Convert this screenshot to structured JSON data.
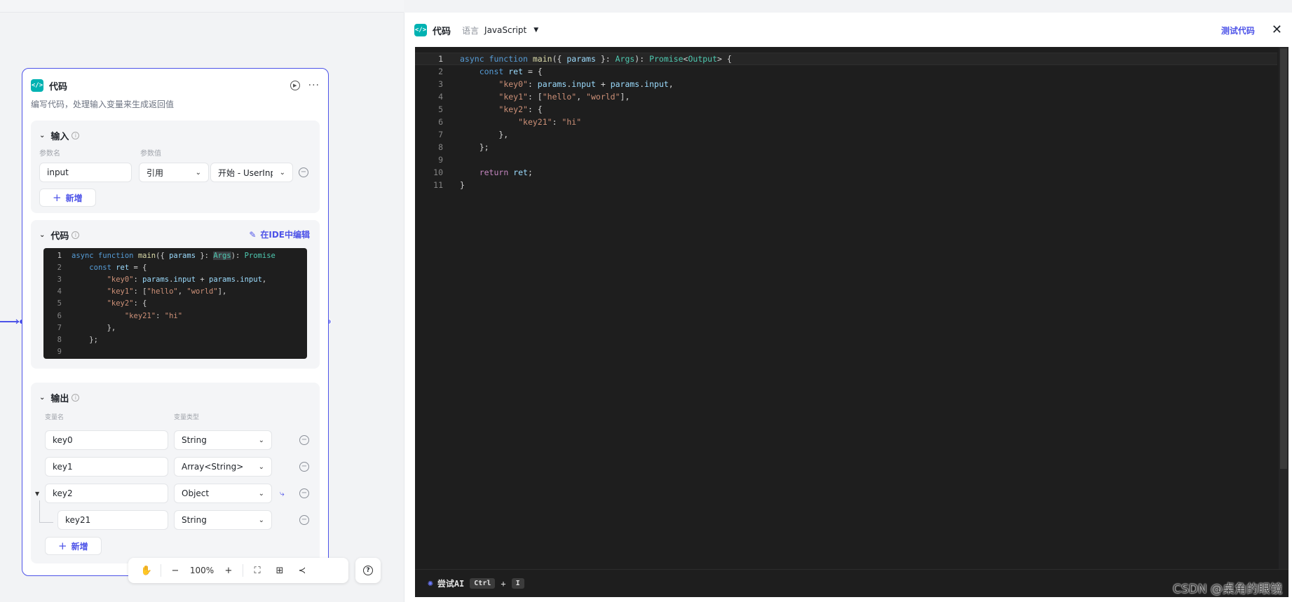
{
  "node": {
    "title": "代码",
    "description": "编写代码，处理输入变量来生成返回值",
    "input": {
      "title": "输入",
      "name_label": "参数名",
      "value_label": "参数值",
      "param_name": "input",
      "ref_mode": "引用",
      "ref_value": "开始 - UserInput",
      "add_label": "新增"
    },
    "code": {
      "title": "代码",
      "ide_link": "在IDE中编辑",
      "lines": [
        {
          "n": "1",
          "text": "async function main({ params }: Args): Promise"
        },
        {
          "n": "2",
          "text": "    const ret = {"
        },
        {
          "n": "3",
          "text": "        \"key0\": params.input + params.input,"
        },
        {
          "n": "4",
          "text": "        \"key1\": [\"hello\", \"world\"],"
        },
        {
          "n": "5",
          "text": "        \"key2\": {"
        },
        {
          "n": "6",
          "text": "            \"key21\": \"hi\""
        },
        {
          "n": "7",
          "text": "        },"
        },
        {
          "n": "8",
          "text": "    };"
        },
        {
          "n": "9",
          "text": ""
        }
      ]
    },
    "output": {
      "title": "输出",
      "name_label": "变量名",
      "type_label": "变量类型",
      "rows": [
        {
          "name": "key0",
          "type": "String"
        },
        {
          "name": "key1",
          "type": "Array<String>"
        },
        {
          "name": "key2",
          "type": "Object"
        },
        {
          "name": "key21",
          "type": "String"
        }
      ],
      "add_label": "新增"
    }
  },
  "toolbar": {
    "zoom": "100%"
  },
  "ide": {
    "title": "代码",
    "language_label": "语言",
    "language": "JavaScript",
    "test_label": "测试代码",
    "line_numbers": [
      "1",
      "2",
      "3",
      "4",
      "5",
      "6",
      "7",
      "8",
      "9",
      "10",
      "11"
    ],
    "ai_label": "尝试AI",
    "shortcut_key1": "Ctrl",
    "shortcut_plus": "+",
    "shortcut_key2": "I"
  },
  "watermark": "CSDN @桌角的眼镜",
  "colors": {
    "accent": "#4d53e8",
    "code_icon": "#00b2b2",
    "editor_bg": "#1e1e1e"
  }
}
